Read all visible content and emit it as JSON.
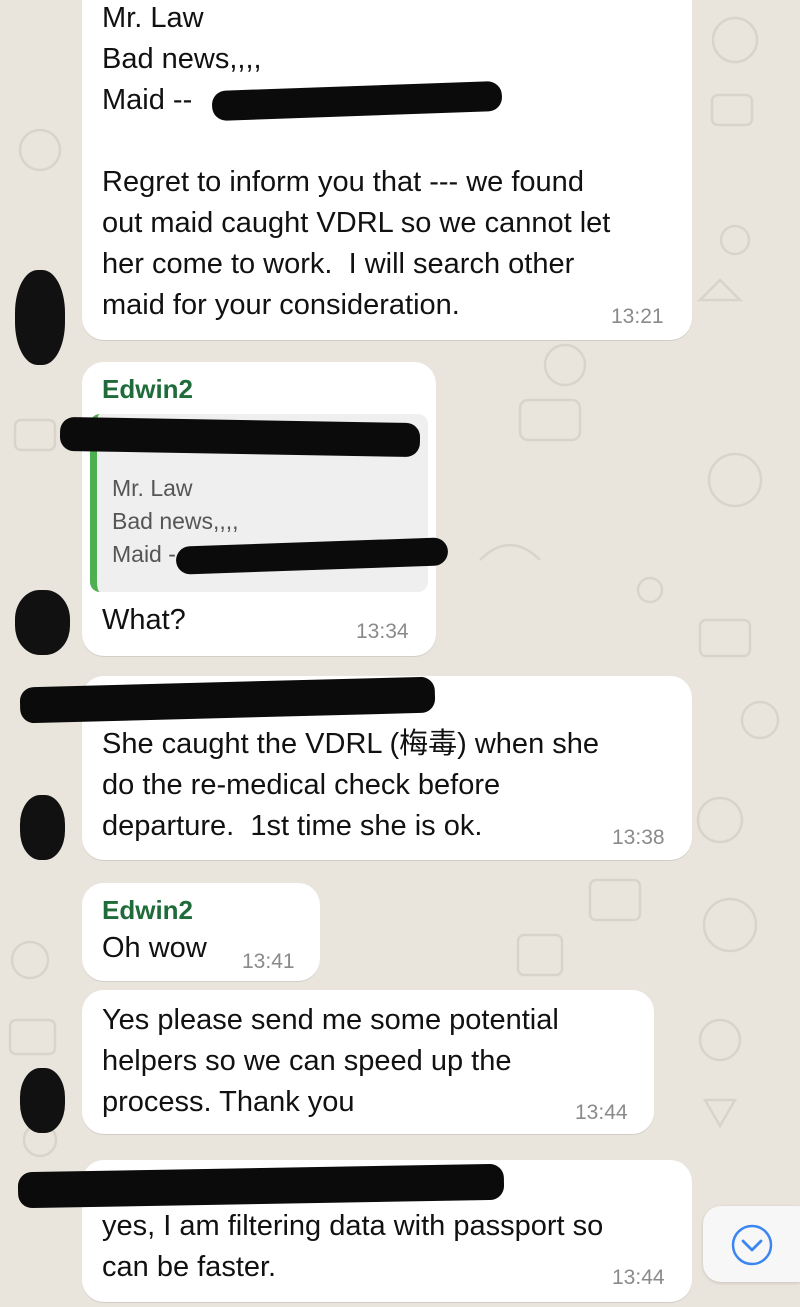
{
  "messages": [
    {
      "lines": [
        "Mr. Law",
        "Bad news,,,,",
        "Maid --"
      ],
      "body": "Regret to inform you that --- we found\nout maid caught VDRL so we cannot let\nher come to work.  I will search other\nmaid for your consideration.",
      "time": "13:21"
    },
    {
      "sender": "Edwin2",
      "quote": [
        "Mr. Law",
        "Bad news,,,,",
        "Maid -"
      ],
      "text": "What?",
      "time": "13:34"
    },
    {
      "text": "She caught the VDRL (梅毒) when she\ndo the re-medical check before\ndeparture.  1st time she is ok.",
      "time": "13:38"
    },
    {
      "sender": "Edwin2",
      "text": "Oh wow",
      "time": "13:41"
    },
    {
      "text": "Yes please send me some potential\nhelpers so we can speed up the\nprocess. Thank you",
      "time": "13:44"
    },
    {
      "text": "yes, I am filtering data with passport so\ncan be faster.",
      "time": "13:44"
    }
  ],
  "icons": {
    "scroll_down": "chevron-down-circle-icon",
    "accent": "#3b86f0",
    "sender_color": "#1f6b3a",
    "quote_bar_color": "#4caf50"
  }
}
